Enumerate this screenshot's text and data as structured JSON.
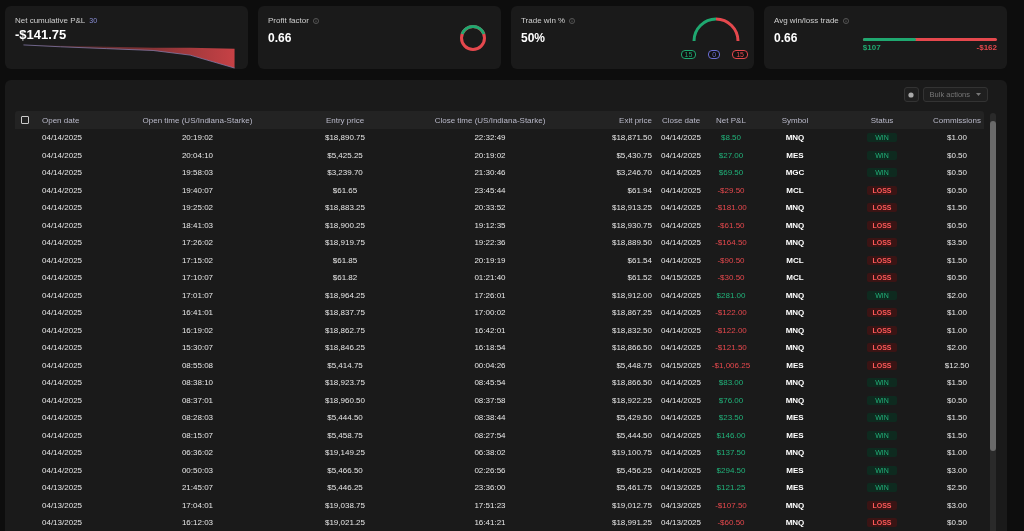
{
  "cards": [
    {
      "kind": "sparkline",
      "label": "Net cumulative P&L",
      "badge": "30",
      "value": "-$141.75"
    },
    {
      "kind": "donut",
      "label": "Profit factor",
      "value": "0.66"
    },
    {
      "kind": "gauge",
      "label": "Trade win %",
      "value": "50%",
      "counts": [
        {
          "text": "15",
          "color": "#1fa870"
        },
        {
          "text": "0",
          "color": "#6b6fd6"
        },
        {
          "text": "15",
          "color": "#e5484d"
        }
      ]
    },
    {
      "kind": "bar",
      "label": "Avg win/loss trade",
      "value": "0.66",
      "level": 0.4,
      "win": "$107",
      "loss": "-$162"
    }
  ],
  "toolbar": {
    "bulk_actions": "Bulk actions"
  },
  "table": {
    "select_all": {
      "checked": false
    },
    "columns": [
      "Open date",
      "Open time (US/Indiana-Starke)",
      "Entry price",
      "Close time (US/Indiana-Starke)",
      "Exit price",
      "Close date",
      "Net P&L",
      "Symbol",
      "Status",
      "Commissions"
    ],
    "rows": [
      {
        "kind": "win",
        "cells": [
          "04/14/2025",
          "20:19:02",
          "$18,890.75",
          "22:32:49",
          "$18,871.50",
          "04/14/2025",
          "$8.50",
          "MNQ",
          "WIN",
          "$1.00"
        ]
      },
      {
        "kind": "win",
        "cells": [
          "04/14/2025",
          "20:04:10",
          "$5,425.25",
          "20:19:02",
          "$5,430.75",
          "04/14/2025",
          "$27.00",
          "MES",
          "WIN",
          "$0.50"
        ]
      },
      {
        "kind": "win",
        "cells": [
          "04/14/2025",
          "19:58:03",
          "$3,239.70",
          "21:30:46",
          "$3,246.70",
          "04/14/2025",
          "$69.50",
          "MGC",
          "WIN",
          "$0.50"
        ]
      },
      {
        "kind": "loss",
        "cells": [
          "04/14/2025",
          "19:40:07",
          "$61.65",
          "23:45:44",
          "$61.94",
          "04/14/2025",
          "-$29.50",
          "MCL",
          "LOSS",
          "$0.50"
        ]
      },
      {
        "kind": "loss",
        "cells": [
          "04/14/2025",
          "19:25:02",
          "$18,883.25",
          "20:33:52",
          "$18,913.25",
          "04/14/2025",
          "-$181.00",
          "MNQ",
          "LOSS",
          "$1.50"
        ]
      },
      {
        "kind": "loss",
        "cells": [
          "04/14/2025",
          "18:41:03",
          "$18,900.25",
          "19:12:35",
          "$18,930.75",
          "04/14/2025",
          "-$61.50",
          "MNQ",
          "LOSS",
          "$0.50"
        ]
      },
      {
        "kind": "loss",
        "cells": [
          "04/14/2025",
          "17:26:02",
          "$18,919.75",
          "19:22:36",
          "$18,889.50",
          "04/14/2025",
          "-$164.50",
          "MNQ",
          "LOSS",
          "$3.50"
        ]
      },
      {
        "kind": "loss",
        "cells": [
          "04/14/2025",
          "17:15:02",
          "$61.85",
          "20:19:19",
          "$61.54",
          "04/14/2025",
          "-$90.50",
          "MCL",
          "LOSS",
          "$1.50"
        ]
      },
      {
        "kind": "loss",
        "cells": [
          "04/14/2025",
          "17:10:07",
          "$61.82",
          "01:21:40",
          "$61.52",
          "04/15/2025",
          "-$30.50",
          "MCL",
          "LOSS",
          "$0.50"
        ]
      },
      {
        "kind": "win",
        "cells": [
          "04/14/2025",
          "17:01:07",
          "$18,964.25",
          "17:26:01",
          "$18,912.00",
          "04/14/2025",
          "$281.00",
          "MNQ",
          "WIN",
          "$2.00"
        ]
      },
      {
        "kind": "loss",
        "cells": [
          "04/14/2025",
          "16:41:01",
          "$18,837.75",
          "17:00:02",
          "$18,867.25",
          "04/14/2025",
          "-$122.00",
          "MNQ",
          "LOSS",
          "$1.00"
        ]
      },
      {
        "kind": "loss",
        "cells": [
          "04/14/2025",
          "16:19:02",
          "$18,862.75",
          "16:42:01",
          "$18,832.50",
          "04/14/2025",
          "-$122.00",
          "MNQ",
          "LOSS",
          "$1.00"
        ]
      },
      {
        "kind": "loss",
        "cells": [
          "04/14/2025",
          "15:30:07",
          "$18,846.25",
          "16:18:54",
          "$18,866.50",
          "04/14/2025",
          "-$121.50",
          "MNQ",
          "LOSS",
          "$2.00"
        ]
      },
      {
        "kind": "loss",
        "cells": [
          "04/14/2025",
          "08:55:08",
          "$5,414.75",
          "00:04:26",
          "$5,448.75",
          "04/15/2025",
          "-$1,006.25",
          "MES",
          "LOSS",
          "$12.50"
        ]
      },
      {
        "kind": "win",
        "cells": [
          "04/14/2025",
          "08:38:10",
          "$18,923.75",
          "08:45:54",
          "$18,866.50",
          "04/14/2025",
          "$83.00",
          "MNQ",
          "WIN",
          "$1.50"
        ]
      },
      {
        "kind": "win",
        "cells": [
          "04/14/2025",
          "08:37:01",
          "$18,960.50",
          "08:37:58",
          "$18,922.25",
          "04/14/2025",
          "$76.00",
          "MNQ",
          "WIN",
          "$0.50"
        ]
      },
      {
        "kind": "win",
        "cells": [
          "04/14/2025",
          "08:28:03",
          "$5,444.50",
          "08:38:44",
          "$5,429.50",
          "04/14/2025",
          "$23.50",
          "MES",
          "WIN",
          "$1.50"
        ]
      },
      {
        "kind": "win",
        "cells": [
          "04/14/2025",
          "08:15:07",
          "$5,458.75",
          "08:27:54",
          "$5,444.50",
          "04/14/2025",
          "$146.00",
          "MES",
          "WIN",
          "$1.50"
        ]
      },
      {
        "kind": "win",
        "cells": [
          "04/14/2025",
          "06:36:02",
          "$19,149.25",
          "06:38:02",
          "$19,100.75",
          "04/14/2025",
          "$137.50",
          "MNQ",
          "WIN",
          "$1.00"
        ]
      },
      {
        "kind": "win",
        "cells": [
          "04/14/2025",
          "00:50:03",
          "$5,466.50",
          "02:26:56",
          "$5,456.25",
          "04/14/2025",
          "$294.50",
          "MES",
          "WIN",
          "$3.00"
        ]
      },
      {
        "kind": "win",
        "cells": [
          "04/13/2025",
          "21:45:07",
          "$5,446.25",
          "23:36:00",
          "$5,461.75",
          "04/13/2025",
          "$121.25",
          "MES",
          "WIN",
          "$2.50"
        ]
      },
      {
        "kind": "loss",
        "cells": [
          "04/13/2025",
          "17:04:01",
          "$19,038.75",
          "17:51:23",
          "$19,012.75",
          "04/13/2025",
          "-$107.50",
          "MNQ",
          "LOSS",
          "$3.00"
        ]
      },
      {
        "kind": "loss",
        "cells": [
          "04/13/2025",
          "16:12:03",
          "$19,021.25",
          "16:41:21",
          "$18,991.25",
          "04/13/2025",
          "-$60.50",
          "MNQ",
          "LOSS",
          "$0.50"
        ]
      }
    ]
  }
}
